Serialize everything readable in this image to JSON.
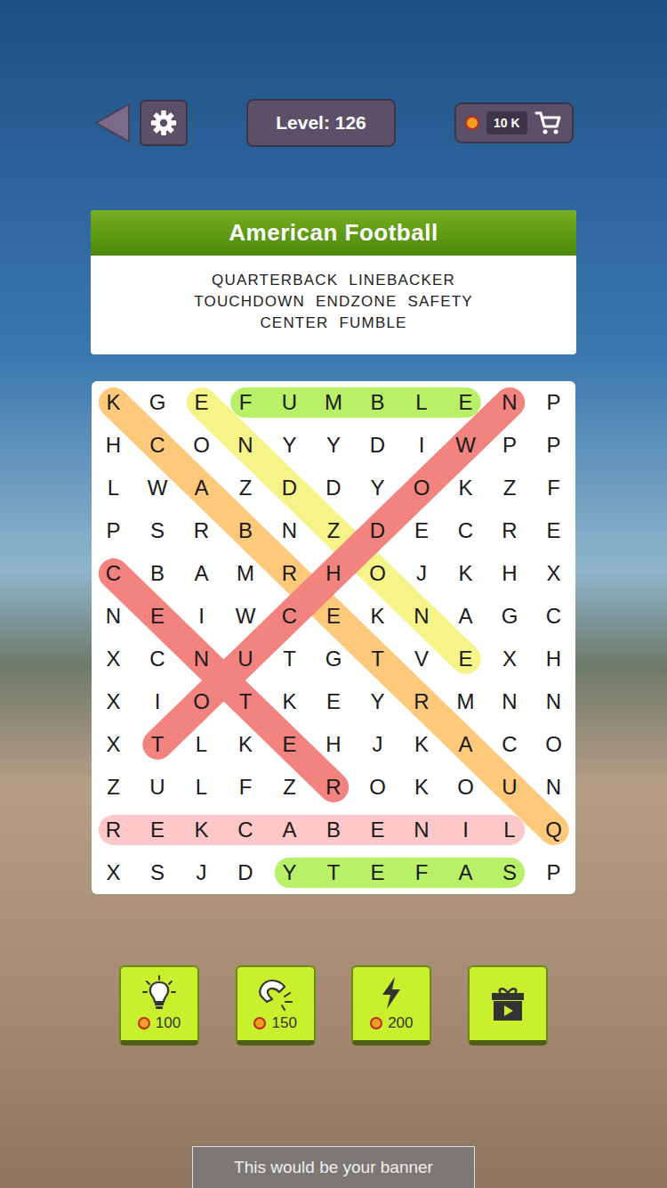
{
  "level": "Level: 126",
  "coins": "10 K",
  "category": "American Football",
  "word_rows": [
    [
      "QUARTERBACK",
      "LINEBACKER"
    ],
    [
      "TOUCHDOWN",
      "ENDZONE",
      "SAFETY"
    ],
    [
      "CENTER",
      "FUMBLE"
    ]
  ],
  "grid": [
    "KGEFUMBLENP",
    "HCONYYDIWPP",
    "LWAZDDYOKZF",
    "PSRBNZDECRE",
    "CBAMRHOJKHX",
    "NEIWCEKNAGC",
    "XCNUTGTVEXH",
    "XIOTKEYRMNN",
    "XTLKEHJKACO",
    "ZULFZROKOUN",
    "REKCABENILQ",
    "XSJDYTEFASP"
  ],
  "found": [
    {
      "from": [
        0,
        3
      ],
      "to": [
        0,
        8
      ],
      "color": "#b8f068"
    },
    {
      "from": [
        11,
        4
      ],
      "to": [
        11,
        9
      ],
      "color": "#b8f068"
    },
    {
      "from": [
        10,
        0
      ],
      "to": [
        10,
        9
      ],
      "color": "#ffc8c8"
    },
    {
      "from": [
        10,
        10
      ],
      "to": [
        0,
        0
      ],
      "color": "#ffc97c"
    },
    {
      "from": [
        0,
        2
      ],
      "to": [
        6,
        8
      ],
      "color": "#f6f388"
    },
    {
      "from": [
        0,
        9
      ],
      "to": [
        8,
        1
      ],
      "color": "#f3837e"
    },
    {
      "from": [
        4,
        0
      ],
      "to": [
        9,
        5
      ],
      "color": "#f3837e"
    }
  ],
  "boosters": [
    {
      "kind": "hint",
      "cost": "100"
    },
    {
      "kind": "magnet",
      "cost": "150"
    },
    {
      "kind": "bolt",
      "cost": "200"
    },
    {
      "kind": "gift"
    }
  ],
  "banner": "This would be your banner"
}
